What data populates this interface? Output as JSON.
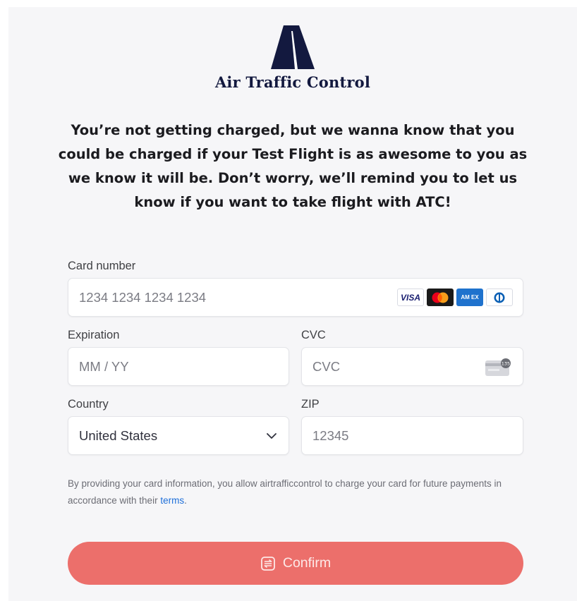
{
  "brand": {
    "name": "Air Traffic Control",
    "logo_icon": "atc-logo-icon",
    "color": "#13193f"
  },
  "headline": "You’re not getting charged, but we wanna know that you could be charged if your Test Flight is as awesome to you as we know it will be. Don’t worry, we’ll remind you to let us know if you want to take flight with ATC!",
  "card_number": {
    "label": "Card number",
    "placeholder": "1234 1234 1234 1234",
    "brands": [
      "visa-icon",
      "mastercard-icon",
      "amex-icon",
      "diners-icon"
    ],
    "visa_text": "VISA",
    "amex_text": "AM EX"
  },
  "expiration": {
    "label": "Expiration",
    "placeholder": "MM / YY"
  },
  "cvc": {
    "label": "CVC",
    "placeholder": "CVC",
    "icon": "cvc-card-icon",
    "icon_text": "135"
  },
  "country": {
    "label": "Country",
    "value": "United States",
    "icon": "chevron-down-icon"
  },
  "zip": {
    "label": "ZIP",
    "placeholder": "12345"
  },
  "notice": {
    "text": "By providing your card information, you allow airtrafficcontrol to charge your card for future payments in accordance with their ",
    "link": "terms",
    "end": "."
  },
  "confirm": {
    "label": "Confirm",
    "icon": "receipt-icon",
    "color": "#ec6f6b"
  }
}
